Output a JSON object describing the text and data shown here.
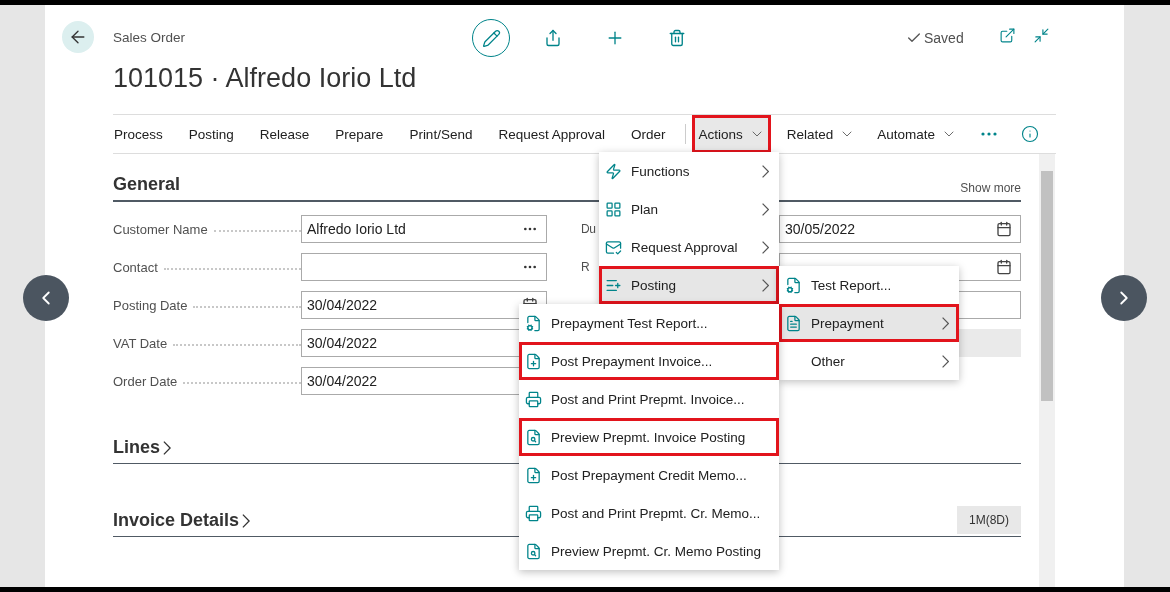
{
  "header": {
    "breadcrumb": "Sales Order",
    "title": "101015 · Alfredo Iorio Ltd",
    "status": "Saved"
  },
  "action_bar": [
    {
      "label": "Process",
      "dropdown": false,
      "selected": false,
      "highlighted": false
    },
    {
      "label": "Posting",
      "dropdown": false,
      "selected": false,
      "highlighted": false
    },
    {
      "label": "Release",
      "dropdown": false,
      "selected": false,
      "highlighted": false
    },
    {
      "label": "Prepare",
      "dropdown": false,
      "selected": false,
      "highlighted": false
    },
    {
      "label": "Print/Send",
      "dropdown": false,
      "selected": false,
      "highlighted": false
    },
    {
      "label": "Request Approval",
      "dropdown": false,
      "selected": false,
      "highlighted": false
    },
    {
      "label": "Order",
      "dropdown": false,
      "selected": false,
      "highlighted": false
    },
    {
      "label": "Actions",
      "dropdown": true,
      "selected": true,
      "highlighted": true
    },
    {
      "label": "Related",
      "dropdown": true,
      "selected": false,
      "highlighted": false
    },
    {
      "label": "Automate",
      "dropdown": true,
      "selected": false,
      "highlighted": false
    }
  ],
  "general": {
    "title": "General",
    "show_more": "Show more",
    "left_fields": [
      {
        "label": "Customer Name",
        "value": "Alfredo Iorio Ltd",
        "kind": "lookup"
      },
      {
        "label": "Contact",
        "kind": "lookup"
      },
      {
        "label": "Posting Date",
        "value": "30/04/2022",
        "kind": "date"
      },
      {
        "label": "VAT Date",
        "value": "30/04/2022",
        "kind": "date"
      },
      {
        "label": "Order Date",
        "value": "30/04/2022",
        "kind": "date"
      }
    ],
    "right_fields": [
      {
        "label": "Du",
        "value": "30/05/2022",
        "kind": "date"
      },
      {
        "label": "R",
        "kind": "date"
      },
      {
        "kind": "text"
      },
      {
        "kind": "readonly"
      }
    ]
  },
  "sections": [
    {
      "title": "Lines"
    },
    {
      "title": "Invoice Details",
      "badge": "1M(8D)"
    }
  ],
  "actions_menu": [
    {
      "label": "Functions",
      "submenu": true,
      "selected": false,
      "highlighted": false
    },
    {
      "label": "Plan",
      "submenu": true,
      "selected": false,
      "highlighted": false
    },
    {
      "label": "Request Approval",
      "submenu": true,
      "selected": false,
      "highlighted": false
    },
    {
      "label": "Posting",
      "submenu": true,
      "selected": true,
      "highlighted": true
    }
  ],
  "posting_menu": [
    {
      "label": "Test Report...",
      "submenu": false,
      "selected": false,
      "highlighted": false
    },
    {
      "label": "Prepayment",
      "submenu": true,
      "selected": true,
      "highlighted": true
    },
    {
      "label": "Other",
      "submenu": true,
      "selected": false,
      "highlighted": false
    }
  ],
  "prepayment_menu": [
    {
      "label": "Prepayment Test Report...",
      "highlighted": false
    },
    {
      "label": "Post Prepayment Invoice...",
      "highlighted": true
    },
    {
      "label": "Post and Print Prepmt. Invoice...",
      "highlighted": false
    },
    {
      "label": "Preview Prepmt. Invoice Posting",
      "highlighted": true
    },
    {
      "label": "Post Prepayment Credit Memo...",
      "highlighted": false
    },
    {
      "label": "Post and Print Prepmt. Cr. Memo...",
      "highlighted": false
    },
    {
      "label": "Preview Prepmt. Cr. Memo Posting",
      "highlighted": false
    }
  ]
}
